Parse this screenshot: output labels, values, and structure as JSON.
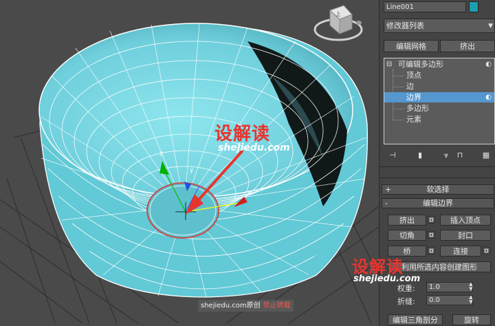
{
  "panel": {
    "object_name": "Line001",
    "object_color": "#1a9fb0",
    "modifier_list": "修改器列表",
    "modifier_arrow": "▼",
    "buttons": {
      "edit_mesh": "编辑网格",
      "extrude": "挤出"
    },
    "stack": {
      "root": "可编辑多边形",
      "expander": "⊟",
      "items": [
        "顶点",
        "边",
        "边界",
        "多边形",
        "元素"
      ],
      "selected_index": 2
    },
    "rollouts": {
      "soft_selection": {
        "sign": "+",
        "label": "软选择"
      },
      "edit_borders": {
        "sign": "-",
        "label": "编辑边界"
      }
    },
    "edit_borders": {
      "extrude": "挤出",
      "insert_vertex": "插入顶点",
      "chamfer": "切角",
      "cap": "封口",
      "bridge": "桥",
      "connect": "连接",
      "create_shape": "利用所选内容创建图形",
      "weight_label": "权重:",
      "weight_value": "1.0",
      "crease_label": "折缝:",
      "crease_value": "0.0",
      "edit_tri": "编辑三角剖分",
      "turn": "旋转"
    }
  },
  "watermarks": {
    "logo": "设解读",
    "url": "shejiedu.com"
  },
  "copyright": {
    "site": "shejiedu.com原创",
    "notice": "禁止转载"
  },
  "viewcube": {
    "face_label": "上"
  },
  "colors": {
    "mesh": "#7fe0ea",
    "wire": "#ffffff",
    "bg": "#4a4a4a",
    "accent": "#e8342e",
    "selected": "#5597cf"
  }
}
